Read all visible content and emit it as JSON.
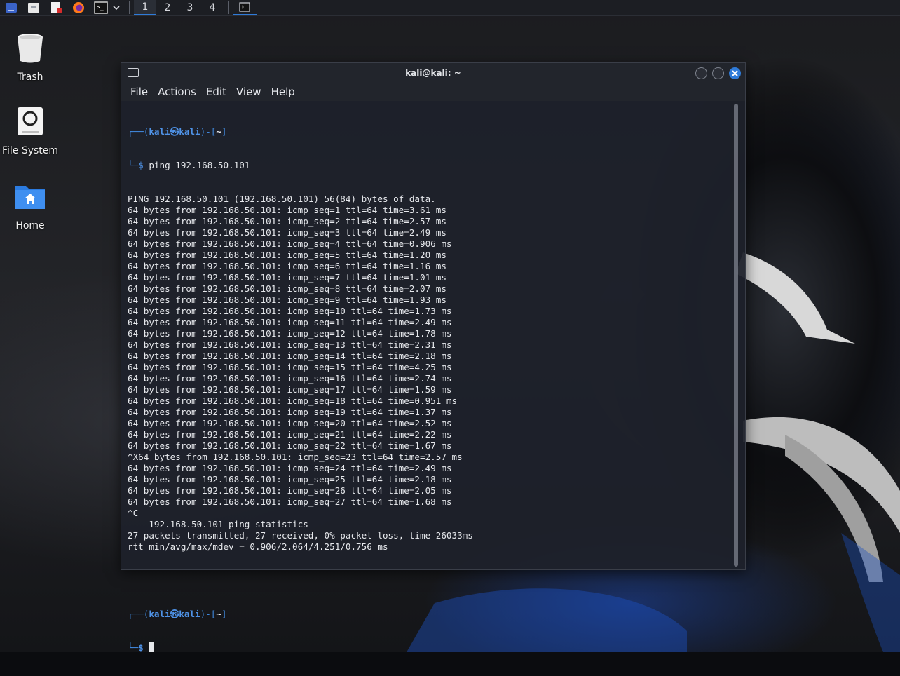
{
  "panel": {
    "workspaces": [
      "1",
      "2",
      "3",
      "4"
    ],
    "active_workspace": "1"
  },
  "desktop": {
    "icons": [
      {
        "label": "Trash",
        "icon": "trash-icon"
      },
      {
        "label": "File System",
        "icon": "drive-icon"
      },
      {
        "label": "Home",
        "icon": "home-folder-icon"
      }
    ]
  },
  "window": {
    "title": "kali@kali: ~",
    "menu": [
      "File",
      "Actions",
      "Edit",
      "View",
      "Help"
    ]
  },
  "terminal": {
    "prompt_user": "kali",
    "prompt_host": "kali",
    "prompt_dir": "~",
    "command": "ping 192.168.50.101",
    "output": [
      "PING 192.168.50.101 (192.168.50.101) 56(84) bytes of data.",
      "64 bytes from 192.168.50.101: icmp_seq=1 ttl=64 time=3.61 ms",
      "64 bytes from 192.168.50.101: icmp_seq=2 ttl=64 time=2.57 ms",
      "64 bytes from 192.168.50.101: icmp_seq=3 ttl=64 time=2.49 ms",
      "64 bytes from 192.168.50.101: icmp_seq=4 ttl=64 time=0.906 ms",
      "64 bytes from 192.168.50.101: icmp_seq=5 ttl=64 time=1.20 ms",
      "64 bytes from 192.168.50.101: icmp_seq=6 ttl=64 time=1.16 ms",
      "64 bytes from 192.168.50.101: icmp_seq=7 ttl=64 time=1.01 ms",
      "64 bytes from 192.168.50.101: icmp_seq=8 ttl=64 time=2.07 ms",
      "64 bytes from 192.168.50.101: icmp_seq=9 ttl=64 time=1.93 ms",
      "64 bytes from 192.168.50.101: icmp_seq=10 ttl=64 time=1.73 ms",
      "64 bytes from 192.168.50.101: icmp_seq=11 ttl=64 time=2.49 ms",
      "64 bytes from 192.168.50.101: icmp_seq=12 ttl=64 time=1.78 ms",
      "64 bytes from 192.168.50.101: icmp_seq=13 ttl=64 time=2.31 ms",
      "64 bytes from 192.168.50.101: icmp_seq=14 ttl=64 time=2.18 ms",
      "64 bytes from 192.168.50.101: icmp_seq=15 ttl=64 time=4.25 ms",
      "64 bytes from 192.168.50.101: icmp_seq=16 ttl=64 time=2.74 ms",
      "64 bytes from 192.168.50.101: icmp_seq=17 ttl=64 time=1.59 ms",
      "64 bytes from 192.168.50.101: icmp_seq=18 ttl=64 time=0.951 ms",
      "64 bytes from 192.168.50.101: icmp_seq=19 ttl=64 time=1.37 ms",
      "64 bytes from 192.168.50.101: icmp_seq=20 ttl=64 time=2.52 ms",
      "64 bytes from 192.168.50.101: icmp_seq=21 ttl=64 time=2.22 ms",
      "64 bytes from 192.168.50.101: icmp_seq=22 ttl=64 time=1.67 ms",
      "^X64 bytes from 192.168.50.101: icmp_seq=23 ttl=64 time=2.57 ms",
      "64 bytes from 192.168.50.101: icmp_seq=24 ttl=64 time=2.49 ms",
      "64 bytes from 192.168.50.101: icmp_seq=25 ttl=64 time=2.18 ms",
      "64 bytes from 192.168.50.101: icmp_seq=26 ttl=64 time=2.05 ms",
      "64 bytes from 192.168.50.101: icmp_seq=27 ttl=64 time=1.68 ms",
      "^C",
      "--- 192.168.50.101 ping statistics ---",
      "27 packets transmitted, 27 received, 0% packet loss, time 26033ms",
      "rtt min/avg/max/mdev = 0.906/2.064/4.251/0.756 ms"
    ]
  },
  "colors": {
    "accent": "#2f7bd9",
    "prompt": "#4f93e8",
    "terminal_bg": "#1e212a",
    "text": "#e6e8ec"
  }
}
